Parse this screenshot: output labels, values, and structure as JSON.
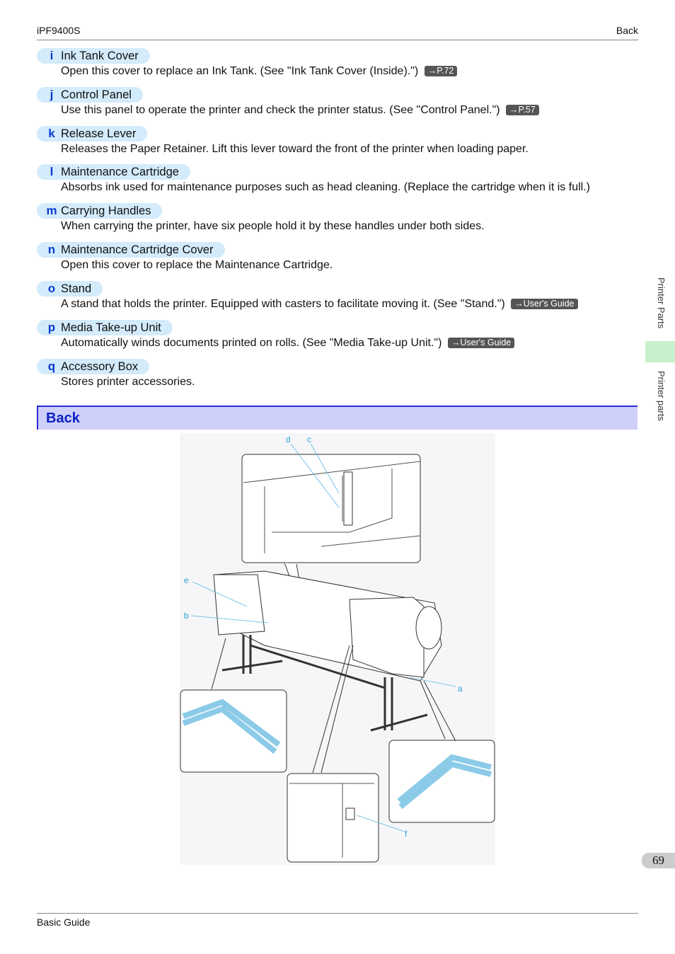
{
  "header": {
    "model": "iPF9400S",
    "section": "Back"
  },
  "items": [
    {
      "letter": "i",
      "title": "Ink Tank Cover",
      "desc": "Open this cover to replace an Ink Tank.  (See \"Ink Tank Cover (Inside).\")",
      "ref": "→P.72"
    },
    {
      "letter": "j",
      "title": "Control Panel",
      "desc": "Use this panel to operate the printer and check the printer status.  (See \"Control Panel.\")",
      "ref": "→P.57"
    },
    {
      "letter": "k",
      "title": "Release Lever",
      "desc": "Releases the Paper Retainer. Lift this lever toward the front of the printer when loading paper."
    },
    {
      "letter": "l",
      "title": "Maintenance Cartridge",
      "desc": "Absorbs ink used for maintenance purposes such as head cleaning. (Replace the cartridge when it is full.)"
    },
    {
      "letter": "m",
      "title": "Carrying Handles",
      "desc": "When carrying the printer, have six people hold it by these handles under both sides."
    },
    {
      "letter": "n",
      "title": "Maintenance Cartridge Cover",
      "desc": "Open this cover to replace the Maintenance Cartridge."
    },
    {
      "letter": "o",
      "title": "Stand",
      "desc": "A stand that holds the printer. Equipped with casters to facilitate moving it.  (See \"Stand.\")",
      "ref": "→User's Guide"
    },
    {
      "letter": "p",
      "title": "Media Take-up Unit",
      "desc": "Automatically winds documents printed on rolls.  (See \"Media Take-up Unit.\")",
      "ref": "→User's Guide"
    },
    {
      "letter": "q",
      "title": "Accessory Box",
      "desc": "Stores printer accessories."
    }
  ],
  "section_title": "Back",
  "figure_labels": {
    "a": "a",
    "b": "b",
    "c": "c",
    "d": "d",
    "e": "e",
    "f": "f"
  },
  "sidebar": {
    "chapter": "Printer Parts",
    "subsection": "Printer parts"
  },
  "page_number": "69",
  "footer": "Basic Guide"
}
